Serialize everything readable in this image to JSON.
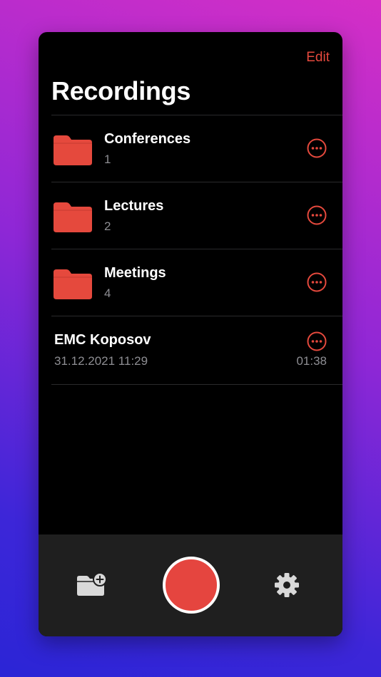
{
  "header": {
    "edit_label": "Edit",
    "title": "Recordings"
  },
  "folders": [
    {
      "name": "Conferences",
      "count": "1"
    },
    {
      "name": "Lectures",
      "count": "2"
    },
    {
      "name": "Meetings",
      "count": "4"
    }
  ],
  "recordings": [
    {
      "name": "EMC Koposov",
      "date": "31.12.2021 11:29",
      "duration": "01:38"
    }
  ],
  "toolbar": {
    "new_folder_icon": "folder-plus-icon",
    "record_icon": "record-icon",
    "settings_icon": "gear-icon"
  },
  "colors": {
    "accent": "#e5493d",
    "folder": "#e5493d",
    "record": "#e5453f",
    "background": "#000000",
    "toolbar_bg": "#1f1f1f",
    "secondary_text": "#8e8e93"
  }
}
